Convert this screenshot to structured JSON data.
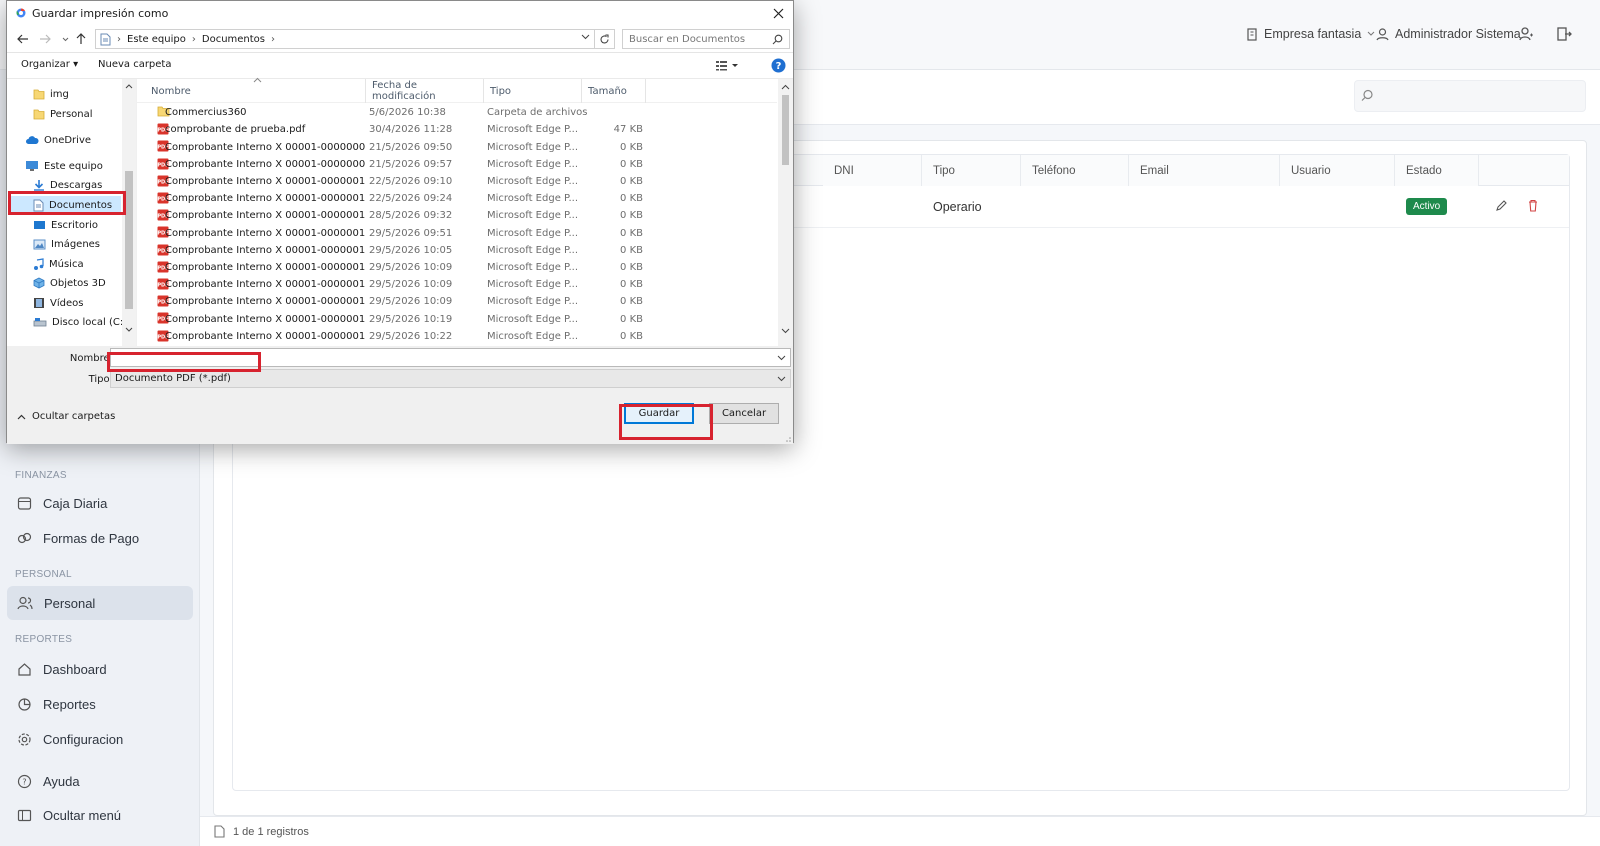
{
  "app": {
    "header": {
      "company": "Empresa fantasia",
      "user": "Administrador Sistema"
    },
    "sidebar": {
      "sections": [
        {
          "title": "FINANZAS",
          "items": [
            {
              "label": "Caja Diaria",
              "icon": "register-icon"
            },
            {
              "label": "Formas de Pago",
              "icon": "card-icon"
            }
          ]
        },
        {
          "title": "PERSONAL",
          "items": [
            {
              "label": "Personal",
              "icon": "people-icon",
              "active": true
            }
          ]
        },
        {
          "title": "REPORTES",
          "items": [
            {
              "label": "Dashboard",
              "icon": "home-icon"
            },
            {
              "label": "Reportes",
              "icon": "chart-icon"
            },
            {
              "label": "Configuracion",
              "icon": "gear-icon"
            }
          ]
        }
      ],
      "help": "Ayuda",
      "hide_menu": "Ocultar menú"
    },
    "table": {
      "columns": [
        "DNI",
        "Tipo",
        "Teléfono",
        "Email",
        "Usuario",
        "Estado"
      ],
      "rows": [
        {
          "dni": "",
          "tipo": "Operario",
          "telefono": "",
          "email": "",
          "usuario": "",
          "estado": "Activo"
        }
      ]
    },
    "footer": {
      "count": "1 de 1 registros"
    }
  },
  "dialog": {
    "title": "Guardar impresión como",
    "breadcrumb": [
      "Este equipo",
      "Documentos"
    ],
    "search_placeholder": "Buscar en Documentos",
    "commands": {
      "organize": "Organizar",
      "new_folder": "Nueva carpeta"
    },
    "nav": [
      {
        "label": "img",
        "icon": "folder-icon"
      },
      {
        "label": "Personal",
        "icon": "folder-icon"
      },
      {
        "label": "OneDrive",
        "icon": "cloud-icon"
      },
      {
        "label": "Este equipo",
        "icon": "computer-icon"
      },
      {
        "label": "Descargas",
        "icon": "download-icon"
      },
      {
        "label": "Documentos",
        "icon": "documents-icon",
        "selected": true
      },
      {
        "label": "Escritorio",
        "icon": "desktop-icon"
      },
      {
        "label": "Imágenes",
        "icon": "pictures-icon"
      },
      {
        "label": "Música",
        "icon": "music-icon"
      },
      {
        "label": "Objetos 3D",
        "icon": "cube-icon"
      },
      {
        "label": "Vídeos",
        "icon": "video-icon"
      },
      {
        "label": "Disco local (C:)",
        "icon": "drive-icon"
      }
    ],
    "columns": [
      "Nombre",
      "Fecha de modificación",
      "Tipo",
      "Tamaño"
    ],
    "files": [
      {
        "name": "Commercius360",
        "date": "5/6/2026 10:38",
        "type": "Carpeta de archivos",
        "size": "",
        "kind": "folder"
      },
      {
        "name": "comprobante de prueba.pdf",
        "date": "30/4/2026 11:28",
        "type": "Microsoft Edge P...",
        "size": "47 KB",
        "kind": "pdf"
      },
      {
        "name": "Comprobante Interno X 00001-00000008....",
        "date": "21/5/2026 09:50",
        "type": "Microsoft Edge P...",
        "size": "0 KB",
        "kind": "pdf"
      },
      {
        "name": "Comprobante Interno X 00001-00000009....",
        "date": "21/5/2026 09:57",
        "type": "Microsoft Edge P...",
        "size": "0 KB",
        "kind": "pdf"
      },
      {
        "name": "Comprobante Interno X 00001-00000010....",
        "date": "22/5/2026 09:10",
        "type": "Microsoft Edge P...",
        "size": "0 KB",
        "kind": "pdf"
      },
      {
        "name": "Comprobante Interno X 00001-00000011....",
        "date": "22/5/2026 09:24",
        "type": "Microsoft Edge P...",
        "size": "0 KB",
        "kind": "pdf"
      },
      {
        "name": "Comprobante Interno X 00001-00000012....",
        "date": "28/5/2026 09:32",
        "type": "Microsoft Edge P...",
        "size": "0 KB",
        "kind": "pdf"
      },
      {
        "name": "Comprobante Interno X 00001-00000013....",
        "date": "29/5/2026 09:51",
        "type": "Microsoft Edge P...",
        "size": "0 KB",
        "kind": "pdf"
      },
      {
        "name": "Comprobante Interno X 00001-00000014....",
        "date": "29/5/2026 10:05",
        "type": "Microsoft Edge P...",
        "size": "0 KB",
        "kind": "pdf"
      },
      {
        "name": "Comprobante Interno X 00001-00000015....",
        "date": "29/5/2026 10:09",
        "type": "Microsoft Edge P...",
        "size": "0 KB",
        "kind": "pdf"
      },
      {
        "name": "Comprobante Interno X 00001-00000016....",
        "date": "29/5/2026 10:09",
        "type": "Microsoft Edge P...",
        "size": "0 KB",
        "kind": "pdf"
      },
      {
        "name": "Comprobante Interno X 00001-00000017....",
        "date": "29/5/2026 10:09",
        "type": "Microsoft Edge P...",
        "size": "0 KB",
        "kind": "pdf"
      },
      {
        "name": "Comprobante Interno X 00001-00000018....",
        "date": "29/5/2026 10:19",
        "type": "Microsoft Edge P...",
        "size": "0 KB",
        "kind": "pdf"
      },
      {
        "name": "Comprobante Interno X 00001-00000019....",
        "date": "29/5/2026 10:22",
        "type": "Microsoft Edge P...",
        "size": "0 KB",
        "kind": "pdf"
      }
    ],
    "filename_label": "Nombre:",
    "filename_value": "",
    "filetype_label": "Tipo:",
    "filetype_value": "Documento PDF (*.pdf)",
    "hide_folders": "Ocultar carpetas",
    "save": "Guardar",
    "cancel": "Cancelar"
  },
  "colors": {
    "highlight": "#d7232f",
    "active_badge": "#1e8a4c",
    "selection": "#cce8ff"
  }
}
